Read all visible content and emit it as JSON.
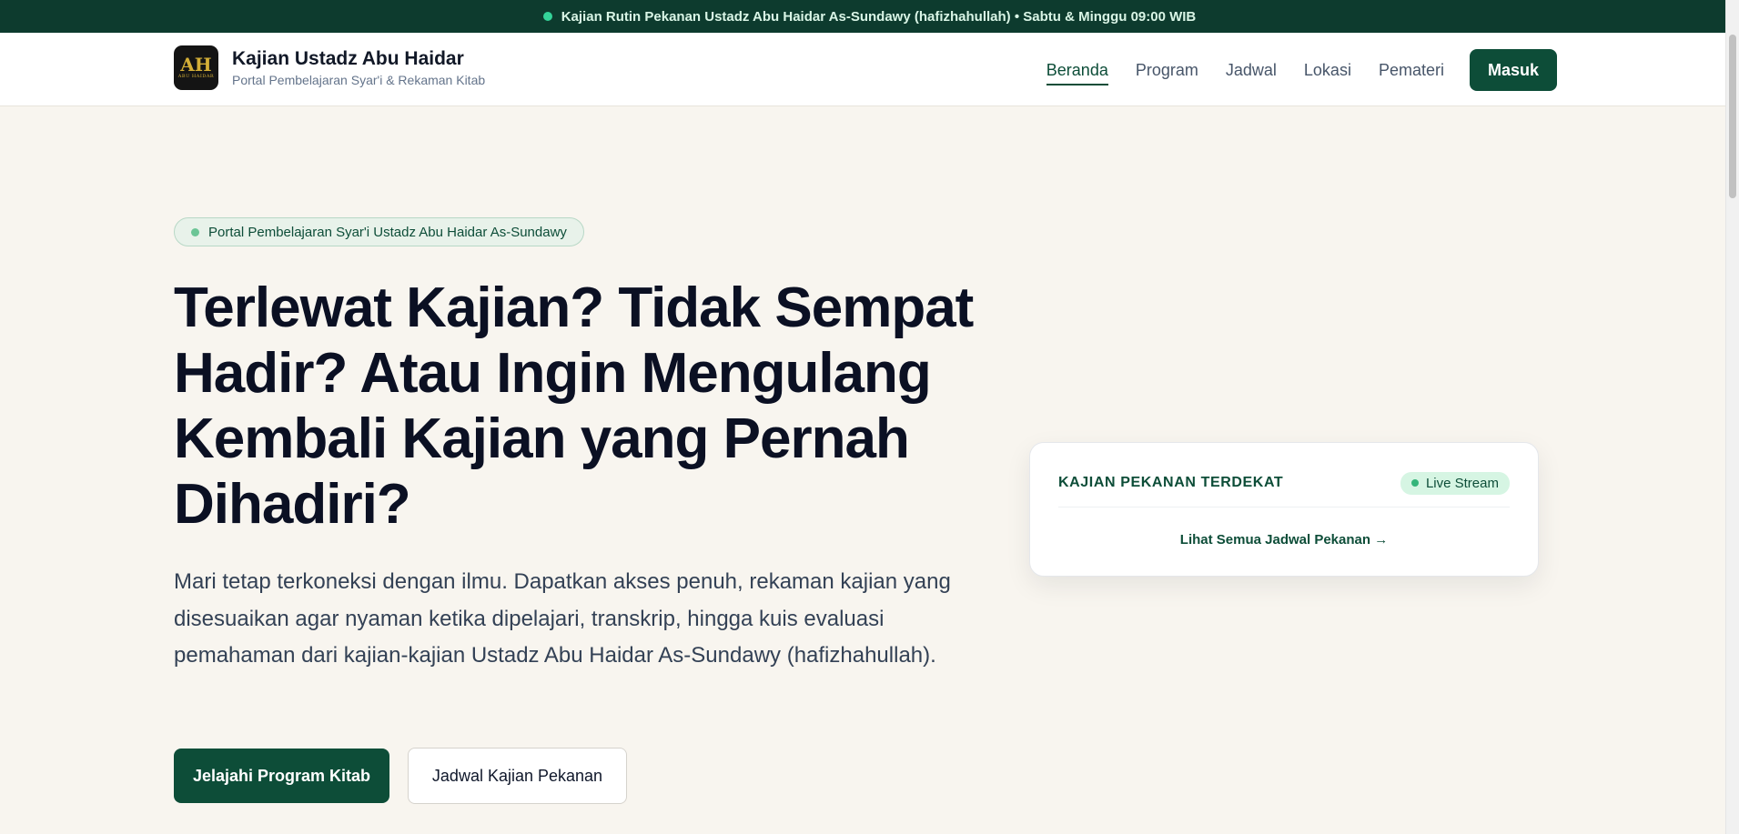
{
  "announcement": {
    "text": "Kajian Rutin Pekanan Ustadz Abu Haidar As-Sundawy (hafizhahullah) • Sabtu & Minggu 09:00 WIB",
    "indicator_color": "#34d399"
  },
  "brand": {
    "title": "Kajian Ustadz Abu Haidar",
    "subtitle": "Portal Pembelajaran Syar'i & Rekaman Kitab",
    "logo_mark": "AH",
    "logo_sub": "ABU HAIDAR"
  },
  "nav": {
    "items": [
      {
        "label": "Beranda",
        "active": true
      },
      {
        "label": "Program",
        "active": false
      },
      {
        "label": "Jadwal",
        "active": false
      },
      {
        "label": "Lokasi",
        "active": false
      },
      {
        "label": "Pemateri",
        "active": false
      }
    ],
    "login_label": "Masuk"
  },
  "hero": {
    "pill_text": "Portal Pembelajaran Syar'i Ustadz Abu Haidar As-Sundawy",
    "title": "Terlewat Kajian? Tidak Sempat Hadir? Atau Ingin Mengulang Kembali Kajian yang Pernah Dihadiri?",
    "description": "Mari tetap terkoneksi dengan ilmu. Dapatkan akses penuh, rekaman kajian yang disesuaikan agar nyaman ketika dipelajari, transkrip, hingga kuis evaluasi pemahaman dari kajian-kajian Ustadz Abu Haidar As-Sundawy (hafizhahullah).",
    "primary_button": "Jelajahi Program Kitab",
    "secondary_button": "Jadwal Kajian Pekanan"
  },
  "card": {
    "title": "KAJIAN PEKANAN TERDEKAT",
    "badge": "Live Stream",
    "link": "Lihat Semua Jadwal Pekanan →"
  },
  "colors": {
    "brand_green": "#0d4d38",
    "topbar_bg": "#0d3b2e",
    "page_bg": "#f8f5ef"
  }
}
